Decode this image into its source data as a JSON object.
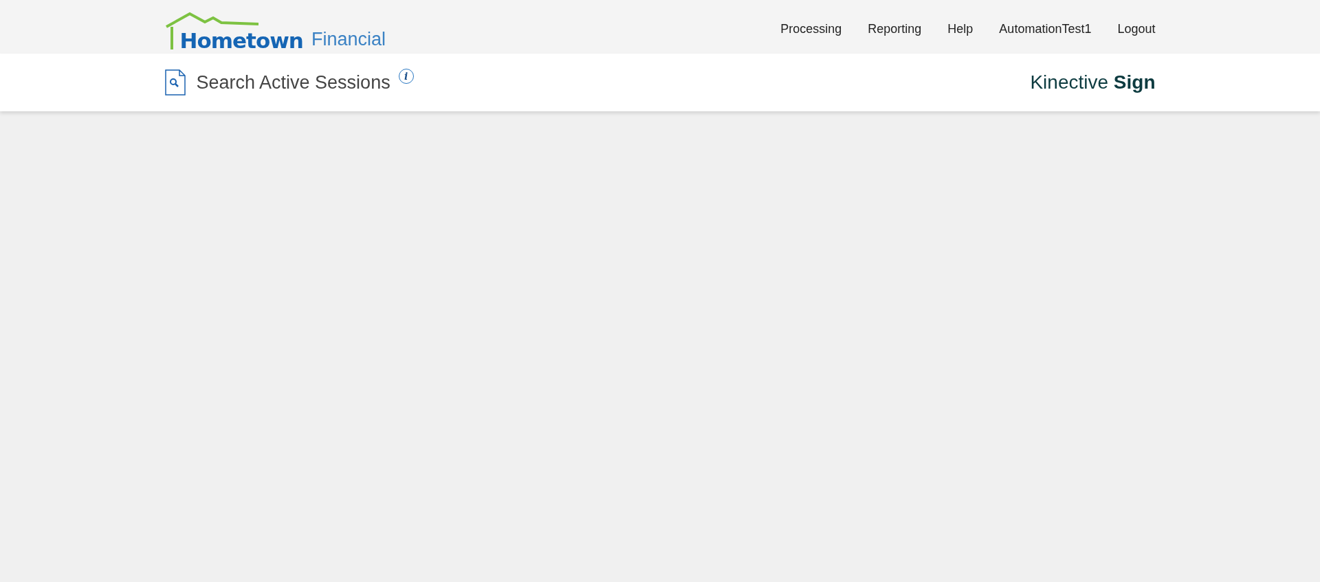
{
  "logo": {
    "primary": "Hometown",
    "secondary": "Financial"
  },
  "nav": [
    {
      "label": "Processing"
    },
    {
      "label": "Reporting"
    },
    {
      "label": "Help"
    },
    {
      "label": "AutomationTest1"
    },
    {
      "label": "Logout"
    }
  ],
  "page_title": "Search Active Sessions",
  "info_icon": "i",
  "brand": "Kinective **Sign**"
}
